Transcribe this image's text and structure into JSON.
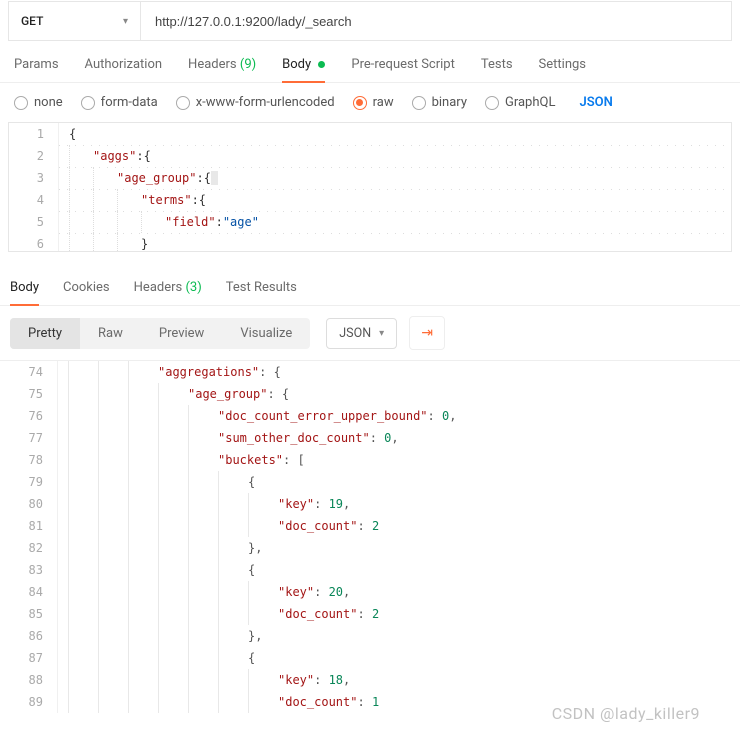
{
  "request": {
    "method": "GET",
    "url": "http://127.0.0.1:9200/lady/_search"
  },
  "requestTabs": {
    "params": "Params",
    "authorization": "Authorization",
    "headers": "Headers",
    "headersCount": "(9)",
    "body": "Body",
    "prerequest": "Pre-request Script",
    "tests": "Tests",
    "settings": "Settings"
  },
  "bodyTypes": {
    "none": "none",
    "formdata": "form-data",
    "xwww": "x-www-form-urlencoded",
    "raw": "raw",
    "binary": "binary",
    "graphql": "GraphQL",
    "lang": "JSON"
  },
  "requestBody": {
    "l1": "{",
    "l2_key": "\"aggs\"",
    "l2_rest": ":{",
    "l3_key": "\"age_group\"",
    "l3_rest": ":{",
    "l4_key": "\"terms\"",
    "l4_rest": ":{",
    "l5_key": "\"field\"",
    "l5_mid": ":",
    "l5_val": "\"age\"",
    "l6": "}"
  },
  "responseTabs": {
    "body": "Body",
    "cookies": "Cookies",
    "headers": "Headers",
    "headersCount": "(3)",
    "testresults": "Test Results"
  },
  "viewModes": {
    "pretty": "Pretty",
    "raw": "Raw",
    "preview": "Preview",
    "visualize": "Visualize",
    "lang": "JSON"
  },
  "responseBody": {
    "lines": {
      "74": {
        "ind": 3,
        "k": "\"aggregations\"",
        "r": ": {"
      },
      "75": {
        "ind": 4,
        "k": "\"age_group\"",
        "r": ": {"
      },
      "76": {
        "ind": 5,
        "k": "\"doc_count_error_upper_bound\"",
        "m": ": ",
        "v": "0",
        "r": ","
      },
      "77": {
        "ind": 5,
        "k": "\"sum_other_doc_count\"",
        "m": ": ",
        "v": "0",
        "r": ","
      },
      "78": {
        "ind": 5,
        "k": "\"buckets\"",
        "r": ": ["
      },
      "79": {
        "ind": 6,
        "r": "{"
      },
      "80": {
        "ind": 7,
        "k": "\"key\"",
        "m": ": ",
        "v": "19",
        "r": ","
      },
      "81": {
        "ind": 7,
        "k": "\"doc_count\"",
        "m": ": ",
        "v": "2"
      },
      "82": {
        "ind": 6,
        "r": "},"
      },
      "83": {
        "ind": 6,
        "r": "{"
      },
      "84": {
        "ind": 7,
        "k": "\"key\"",
        "m": ": ",
        "v": "20",
        "r": ","
      },
      "85": {
        "ind": 7,
        "k": "\"doc_count\"",
        "m": ": ",
        "v": "2"
      },
      "86": {
        "ind": 6,
        "r": "},"
      },
      "87": {
        "ind": 6,
        "r": "{"
      },
      "88": {
        "ind": 7,
        "k": "\"key\"",
        "m": ": ",
        "v": "18",
        "r": ","
      },
      "89": {
        "ind": 7,
        "k": "\"doc_count\"",
        "m": ": ",
        "v": "1"
      }
    }
  },
  "watermark": "CSDN @lady_killer9"
}
